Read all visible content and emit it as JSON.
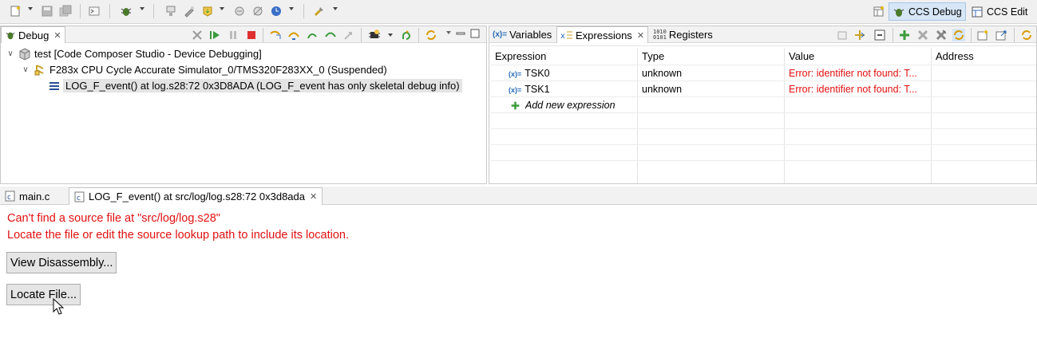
{
  "toolbar": {
    "perspectives": [
      {
        "label": "CCS Debug",
        "icon": "debug-perspective-icon",
        "active": true
      },
      {
        "label": "CCS Edit",
        "icon": "edit-perspective-icon",
        "active": false
      }
    ]
  },
  "debug_view": {
    "tab_label": "Debug",
    "tree": [
      {
        "label": "test [Code Composer Studio - Device Debugging]",
        "expanded": true
      },
      {
        "label": "F283x CPU Cycle Accurate Simulator_0/TMS320F283XX_0 (Suspended)",
        "expanded": true
      },
      {
        "label": "LOG_F_event() at log.s28:72 0x3D8ADA  (LOG_F_event has only skeletal debug info)",
        "selected": true
      }
    ]
  },
  "expressions_view": {
    "tabs": [
      {
        "label": "Variables",
        "active": false
      },
      {
        "label": "Expressions",
        "active": true
      },
      {
        "label": "Registers",
        "active": false
      }
    ],
    "columns": [
      "Expression",
      "Type",
      "Value",
      "Address"
    ],
    "rows": [
      {
        "expression": "TSK0",
        "type": "unknown",
        "value": "Error: identifier not found: T...",
        "address": ""
      },
      {
        "expression": "TSK1",
        "type": "unknown",
        "value": "Error: identifier not found: T...",
        "address": ""
      }
    ],
    "add_new": "Add new expression",
    "error_color": "#e01010"
  },
  "editor": {
    "tabs": [
      {
        "label": "main.c",
        "active": false
      },
      {
        "label": "LOG_F_event() at src/log/log.s28:72 0x3d8ada",
        "active": true
      }
    ],
    "message_line1": "Can't find a source file at \"src/log/log.s28\"",
    "message_line2": "Locate the file or edit the source lookup path to include its location.",
    "view_disassembly_label": "View Disassembly...",
    "locate_file_label": "Locate File..."
  }
}
